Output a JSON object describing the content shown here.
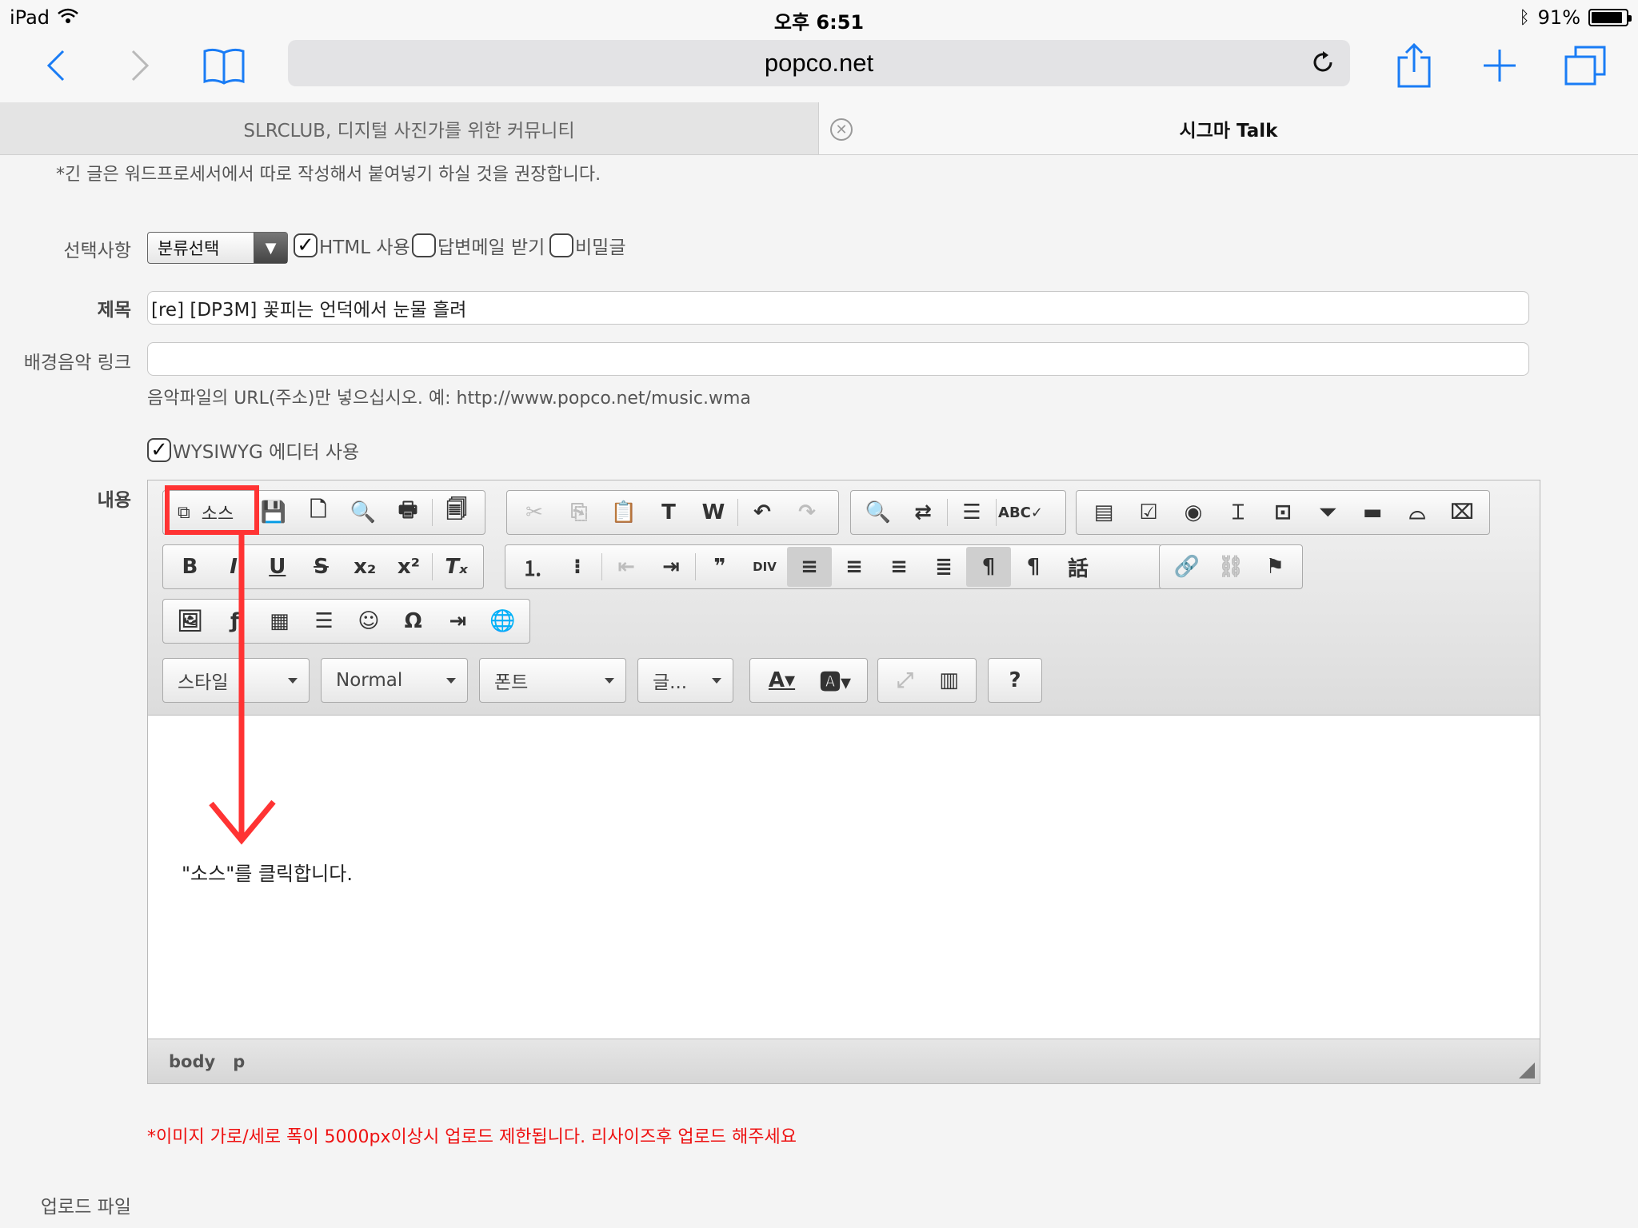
{
  "status": {
    "device": "iPad",
    "time": "오후 6:51",
    "battery": "91%",
    "battery_level": 0.91
  },
  "browser": {
    "url": "popco.net"
  },
  "tabs": [
    {
      "title": "SLRCLUB, 디지털 사진가를 위한 커뮤니티"
    },
    {
      "title": "시그마 Talk"
    }
  ],
  "form": {
    "notice": "*긴 글은 워드프로세서에서 따로 작성해서 붙여넣기 하실 것을 권장합니다.",
    "options_label": "선택사항",
    "category_select": "분류선택",
    "html_checkbox": "HTML 사용",
    "reply_mail_checkbox": "답변메일 받기",
    "secret_checkbox": "비밀글",
    "title_label": "제목",
    "title_value": "[re] [DP3M] 꽃피는 언덕에서 눈물 흘려",
    "bgm_label": "배경음악 링크",
    "bgm_value": "",
    "bgm_hint": "음악파일의 URL(주소)만 넣으십시오. 예: http://www.popco.net/music.wma",
    "wysiwyg_checkbox": "WYSIWYG 에디터 사용",
    "content_label": "내용",
    "upload_label": "업로드 파일",
    "upload_warning": "*이미지 가로/세로 폭이 5000px이상시 업로드 제한됩니다. 리사이즈후 업로드 해주세요"
  },
  "editor": {
    "source_button": "소스",
    "style_combo": "스타일",
    "format_combo": "Normal",
    "font_combo": "폰트",
    "size_combo": "글...",
    "body_text": "\"소스\"를 클릭합니다.",
    "path": [
      "body",
      "p"
    ]
  }
}
